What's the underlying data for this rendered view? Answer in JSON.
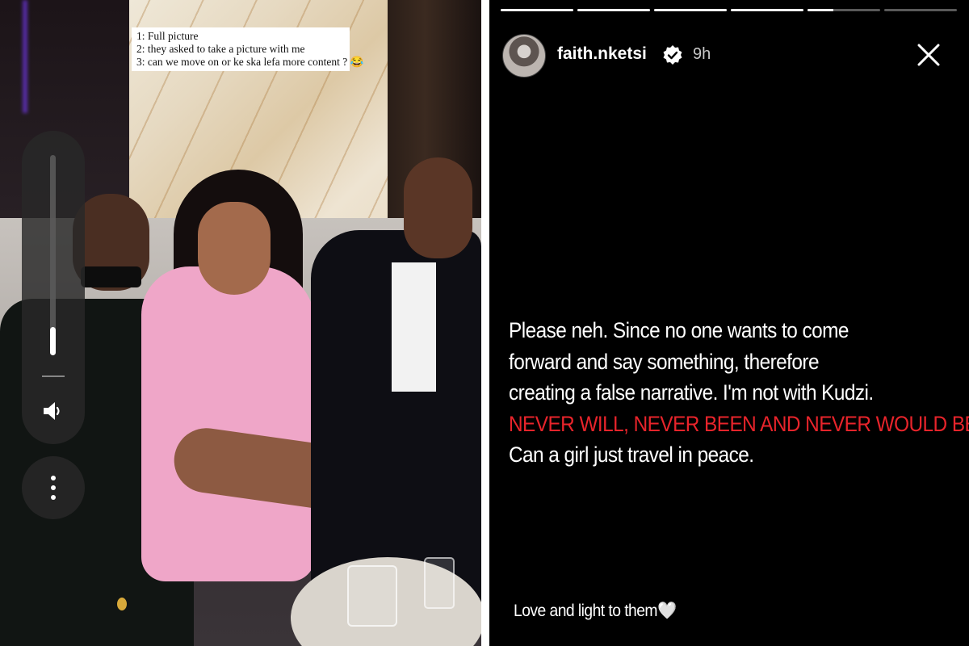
{
  "left_photo": {
    "caption_lines": [
      "1: Full picture",
      "2: they asked to take a picture with me",
      "3: can we move on or ke ska lefa more content ? 😂"
    ],
    "volume_level": 0.14,
    "volume_icon": "speaker-icon",
    "more_icon": "more-vertical-icon"
  },
  "story": {
    "progress_segments": [
      1,
      1,
      1,
      1,
      0.35,
      0
    ],
    "username": "faith.nketsi",
    "verified_icon": "verified-badge-icon",
    "time_ago": "9h",
    "close_icon": "close-icon",
    "body_lines": [
      {
        "text": "Please neh. Since no one wants to come",
        "color": "#ffffff"
      },
      {
        "text": "forward and say something, therefore",
        "color": "#ffffff"
      },
      {
        "text": "creating a false narrative. I'm not with Kudzi.",
        "color": "#ffffff"
      },
      {
        "text": "NEVER WILL, NEVER BEEN AND NEVER WOULD BE.",
        "color": "#e8242b"
      },
      {
        "text": "Can a girl just travel in peace.",
        "color": "#ffffff"
      }
    ],
    "footer": "Love and light to them",
    "footer_emoji": "🤍"
  }
}
